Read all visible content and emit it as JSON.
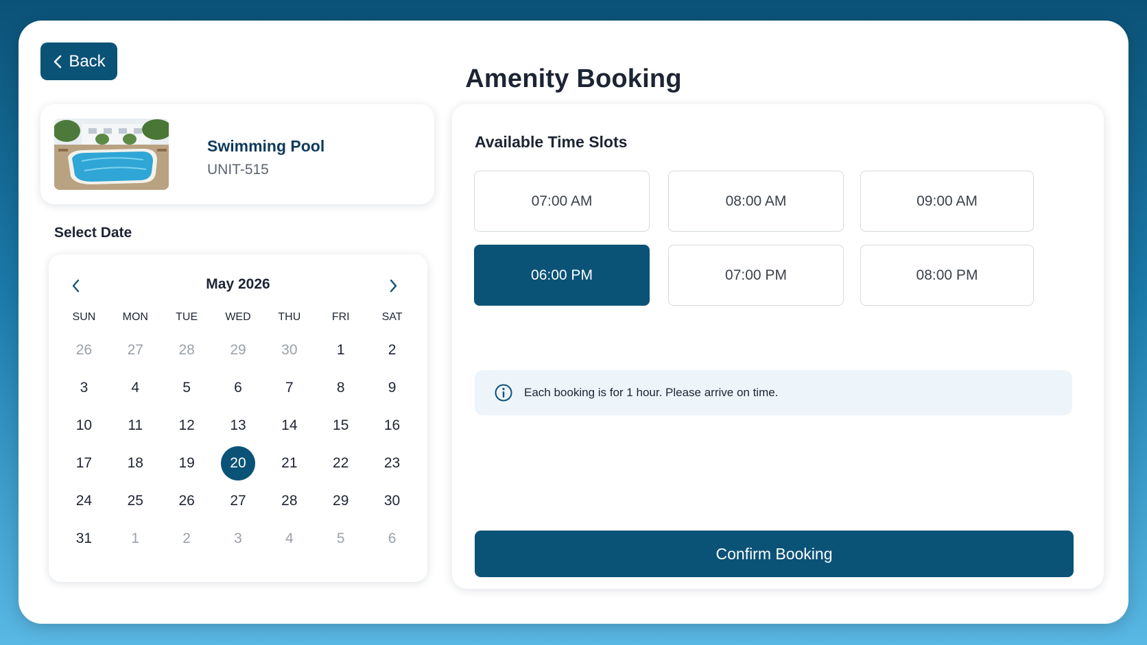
{
  "header": {
    "back_label": "Back",
    "title": "Amenity Booking"
  },
  "amenity": {
    "name": "Swimming Pool",
    "unit": "UNIT-515",
    "photo": "swimming-pool-photo"
  },
  "date_section": {
    "label": "Select Date"
  },
  "calendar": {
    "month_label": "May 2026",
    "days_of_week": [
      "SUN",
      "MON",
      "TUE",
      "WED",
      "THU",
      "FRI",
      "SAT"
    ],
    "weeks": [
      [
        {
          "d": "26",
          "muted": true
        },
        {
          "d": "27",
          "muted": true
        },
        {
          "d": "28",
          "muted": true
        },
        {
          "d": "29",
          "muted": true
        },
        {
          "d": "30",
          "muted": true
        },
        {
          "d": "1"
        },
        {
          "d": "2"
        }
      ],
      [
        {
          "d": "3"
        },
        {
          "d": "4"
        },
        {
          "d": "5"
        },
        {
          "d": "6"
        },
        {
          "d": "7"
        },
        {
          "d": "8"
        },
        {
          "d": "9"
        }
      ],
      [
        {
          "d": "10"
        },
        {
          "d": "11"
        },
        {
          "d": "12"
        },
        {
          "d": "13"
        },
        {
          "d": "14"
        },
        {
          "d": "15"
        },
        {
          "d": "16"
        }
      ],
      [
        {
          "d": "17"
        },
        {
          "d": "18"
        },
        {
          "d": "19"
        },
        {
          "d": "20",
          "selected": true
        },
        {
          "d": "21"
        },
        {
          "d": "22"
        },
        {
          "d": "23"
        }
      ],
      [
        {
          "d": "24"
        },
        {
          "d": "25"
        },
        {
          "d": "26"
        },
        {
          "d": "27"
        },
        {
          "d": "28"
        },
        {
          "d": "29"
        },
        {
          "d": "30"
        }
      ],
      [
        {
          "d": "31"
        },
        {
          "d": "1",
          "muted": true
        },
        {
          "d": "2",
          "muted": true
        },
        {
          "d": "3",
          "muted": true
        },
        {
          "d": "4",
          "muted": true
        },
        {
          "d": "5",
          "muted": true
        },
        {
          "d": "6",
          "muted": true
        }
      ]
    ]
  },
  "time_slots": {
    "title": "Available Time Slots",
    "slots": [
      {
        "label": "07:00 AM"
      },
      {
        "label": "08:00 AM"
      },
      {
        "label": "09:00 AM"
      },
      {
        "label": "06:00 PM",
        "selected": true
      },
      {
        "label": "07:00 PM"
      },
      {
        "label": "08:00 PM"
      }
    ]
  },
  "info": {
    "icon": "info-icon",
    "text": "Each booking is for 1 hour. Please arrive on time."
  },
  "confirm": {
    "label": "Confirm Booking"
  },
  "colors": {
    "primary": "#0b5277",
    "info_bg": "#edf4fa"
  }
}
